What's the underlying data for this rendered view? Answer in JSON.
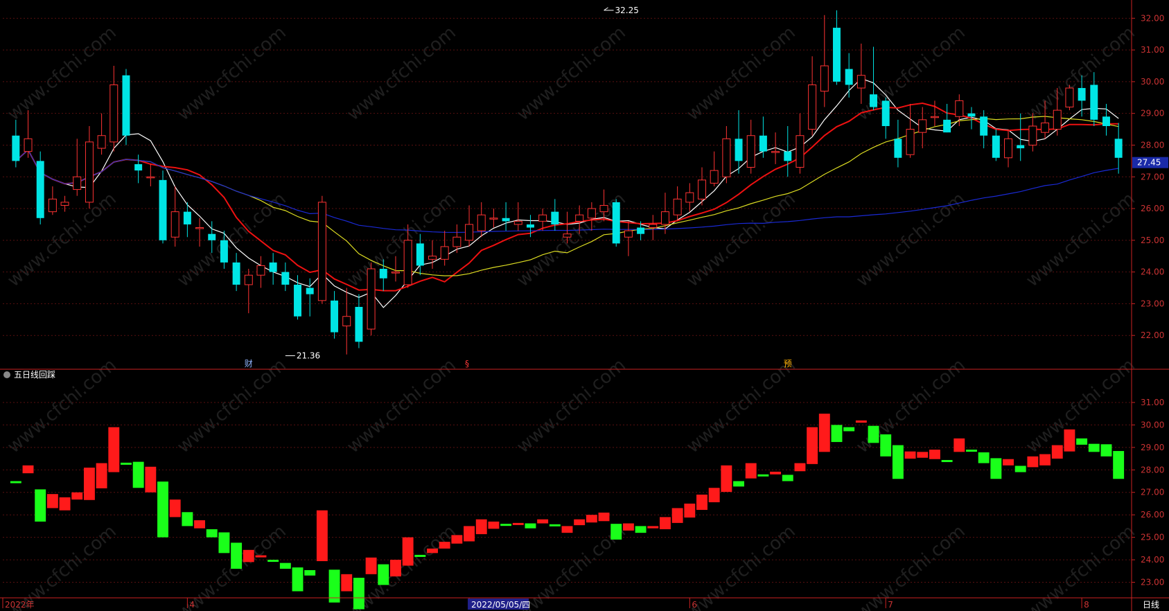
{
  "chart_data": [
    {
      "type": "candlestick",
      "title": "",
      "ylim": [
        21.0,
        32.4
      ],
      "y_ticks": [
        "22.00",
        "23.00",
        "24.00",
        "25.00",
        "26.00",
        "27.00",
        "28.00",
        "29.00",
        "30.00",
        "31.00",
        "32.00"
      ],
      "current_price_label": "27.45",
      "current_price": 27.45,
      "high_annotation": {
        "label": "32.25",
        "value": 32.25,
        "index": 48
      },
      "low_annotation": {
        "label": "21.36",
        "value": 21.36,
        "index": 22
      },
      "event_markers": [
        {
          "label": "财",
          "index": 19,
          "color": "#8fb4ff"
        },
        {
          "label": "§",
          "index": 37,
          "color": "#ff3a3a"
        },
        {
          "label": "预",
          "index": 63,
          "color": "#ffb000"
        }
      ],
      "candles": [
        {
          "o": 28.3,
          "c": 27.5,
          "h": 28.8,
          "l": 27.3
        },
        {
          "o": 27.8,
          "c": 28.2,
          "h": 29.1,
          "l": 27.6
        },
        {
          "o": 27.5,
          "c": 25.7,
          "h": 27.8,
          "l": 25.5
        },
        {
          "o": 25.9,
          "c": 26.3,
          "h": 26.7,
          "l": 25.8
        },
        {
          "o": 26.1,
          "c": 26.2,
          "h": 26.4,
          "l": 25.9
        },
        {
          "o": 26.6,
          "c": 27.0,
          "h": 28.2,
          "l": 26.4
        },
        {
          "o": 26.2,
          "c": 28.1,
          "h": 28.6,
          "l": 26.0
        },
        {
          "o": 27.9,
          "c": 28.3,
          "h": 29.0,
          "l": 27.7
        },
        {
          "o": 28.1,
          "c": 29.9,
          "h": 30.5,
          "l": 27.8
        },
        {
          "o": 30.2,
          "c": 28.3,
          "h": 30.4,
          "l": 28.0
        },
        {
          "o": 27.4,
          "c": 27.2,
          "h": 27.7,
          "l": 26.8
        },
        {
          "o": 27.0,
          "c": 27.0,
          "h": 27.4,
          "l": 26.7
        },
        {
          "o": 26.9,
          "c": 25.0,
          "h": 27.2,
          "l": 24.9
        },
        {
          "o": 25.1,
          "c": 25.9,
          "h": 26.7,
          "l": 24.8
        },
        {
          "o": 25.9,
          "c": 25.5,
          "h": 26.2,
          "l": 25.1
        },
        {
          "o": 25.4,
          "c": 25.4,
          "h": 25.7,
          "l": 24.8
        },
        {
          "o": 25.2,
          "c": 25.0,
          "h": 25.6,
          "l": 24.6
        },
        {
          "o": 25.0,
          "c": 24.3,
          "h": 25.3,
          "l": 24.1
        },
        {
          "o": 24.3,
          "c": 23.6,
          "h": 24.6,
          "l": 23.4
        },
        {
          "o": 23.6,
          "c": 23.9,
          "h": 24.1,
          "l": 22.7
        },
        {
          "o": 23.9,
          "c": 24.2,
          "h": 24.5,
          "l": 23.5
        },
        {
          "o": 24.3,
          "c": 24.0,
          "h": 24.6,
          "l": 23.6
        },
        {
          "o": 24.0,
          "c": 23.6,
          "h": 24.3,
          "l": 23.4
        },
        {
          "o": 23.6,
          "c": 22.6,
          "h": 23.9,
          "l": 22.5
        },
        {
          "o": 23.5,
          "c": 23.3,
          "h": 23.8,
          "l": 22.6
        },
        {
          "o": 23.1,
          "c": 26.2,
          "h": 26.4,
          "l": 23.0
        },
        {
          "o": 23.1,
          "c": 22.1,
          "h": 23.4,
          "l": 21.9
        },
        {
          "o": 22.3,
          "c": 22.6,
          "h": 23.5,
          "l": 21.4
        },
        {
          "o": 22.9,
          "c": 21.8,
          "h": 23.3,
          "l": 21.6
        },
        {
          "o": 22.2,
          "c": 24.1,
          "h": 24.3,
          "l": 22.0
        },
        {
          "o": 24.1,
          "c": 23.8,
          "h": 24.4,
          "l": 23.4
        },
        {
          "o": 24.0,
          "c": 24.0,
          "h": 24.5,
          "l": 23.7
        },
        {
          "o": 23.6,
          "c": 25.0,
          "h": 25.5,
          "l": 23.5
        },
        {
          "o": 24.9,
          "c": 24.2,
          "h": 25.2,
          "l": 23.9
        },
        {
          "o": 24.4,
          "c": 24.5,
          "h": 25.0,
          "l": 24.1
        },
        {
          "o": 24.4,
          "c": 24.8,
          "h": 25.3,
          "l": 24.2
        },
        {
          "o": 24.8,
          "c": 25.1,
          "h": 25.5,
          "l": 24.6
        },
        {
          "o": 25.0,
          "c": 25.5,
          "h": 26.1,
          "l": 24.8
        },
        {
          "o": 25.3,
          "c": 25.8,
          "h": 26.2,
          "l": 25.1
        },
        {
          "o": 25.7,
          "c": 25.7,
          "h": 26.0,
          "l": 25.4
        },
        {
          "o": 25.7,
          "c": 25.6,
          "h": 26.2,
          "l": 25.3
        },
        {
          "o": 25.5,
          "c": 25.6,
          "h": 26.2,
          "l": 25.3
        },
        {
          "o": 25.5,
          "c": 25.4,
          "h": 25.8,
          "l": 25.1
        },
        {
          "o": 25.6,
          "c": 25.8,
          "h": 26.0,
          "l": 25.3
        },
        {
          "o": 25.9,
          "c": 25.5,
          "h": 26.3,
          "l": 25.3
        },
        {
          "o": 25.1,
          "c": 25.2,
          "h": 25.9,
          "l": 24.9
        },
        {
          "o": 25.6,
          "c": 25.8,
          "h": 26.1,
          "l": 25.2
        },
        {
          "o": 25.7,
          "c": 26.0,
          "h": 26.2,
          "l": 25.3
        },
        {
          "o": 25.9,
          "c": 26.1,
          "h": 26.6,
          "l": 25.6
        },
        {
          "o": 26.2,
          "c": 24.9,
          "h": 26.3,
          "l": 24.8
        },
        {
          "o": 25.1,
          "c": 25.3,
          "h": 25.6,
          "l": 24.5
        },
        {
          "o": 25.4,
          "c": 25.2,
          "h": 25.6,
          "l": 25.0
        },
        {
          "o": 25.4,
          "c": 25.5,
          "h": 25.8,
          "l": 25.0
        },
        {
          "o": 25.5,
          "c": 25.9,
          "h": 26.5,
          "l": 25.2
        },
        {
          "o": 25.8,
          "c": 26.3,
          "h": 26.7,
          "l": 25.6
        },
        {
          "o": 26.2,
          "c": 26.5,
          "h": 26.8,
          "l": 25.9
        },
        {
          "o": 26.3,
          "c": 26.9,
          "h": 27.3,
          "l": 26.1
        },
        {
          "o": 26.8,
          "c": 27.2,
          "h": 27.8,
          "l": 26.7
        },
        {
          "o": 27.0,
          "c": 28.2,
          "h": 28.6,
          "l": 26.8
        },
        {
          "o": 28.2,
          "c": 27.5,
          "h": 29.1,
          "l": 27.1
        },
        {
          "o": 27.3,
          "c": 28.3,
          "h": 28.8,
          "l": 27.1
        },
        {
          "o": 28.3,
          "c": 27.8,
          "h": 28.9,
          "l": 27.6
        },
        {
          "o": 27.8,
          "c": 27.8,
          "h": 28.4,
          "l": 27.4
        },
        {
          "o": 27.8,
          "c": 27.5,
          "h": 28.6,
          "l": 27.0
        },
        {
          "o": 27.3,
          "c": 28.3,
          "h": 29.0,
          "l": 27.1
        },
        {
          "o": 28.5,
          "c": 29.9,
          "h": 30.8,
          "l": 28.3
        },
        {
          "o": 29.7,
          "c": 30.5,
          "h": 32.1,
          "l": 29.2
        },
        {
          "o": 31.7,
          "c": 30.0,
          "h": 32.25,
          "l": 29.9
        },
        {
          "o": 30.4,
          "c": 29.9,
          "h": 30.9,
          "l": 29.5
        },
        {
          "o": 29.8,
          "c": 30.2,
          "h": 31.2,
          "l": 29.3
        },
        {
          "o": 29.6,
          "c": 29.2,
          "h": 31.1,
          "l": 29.1
        },
        {
          "o": 29.4,
          "c": 28.6,
          "h": 29.5,
          "l": 28.2
        },
        {
          "o": 28.2,
          "c": 27.6,
          "h": 28.8,
          "l": 27.3
        },
        {
          "o": 27.7,
          "c": 28.5,
          "h": 29.3,
          "l": 27.6
        },
        {
          "o": 28.4,
          "c": 28.8,
          "h": 29.2,
          "l": 27.9
        },
        {
          "o": 28.9,
          "c": 28.9,
          "h": 29.4,
          "l": 28.6
        },
        {
          "o": 28.8,
          "c": 28.4,
          "h": 29.3,
          "l": 28.4
        },
        {
          "o": 28.9,
          "c": 29.4,
          "h": 29.6,
          "l": 28.6
        },
        {
          "o": 29.0,
          "c": 28.9,
          "h": 29.2,
          "l": 28.5
        },
        {
          "o": 28.9,
          "c": 28.3,
          "h": 29.1,
          "l": 27.9
        },
        {
          "o": 28.3,
          "c": 27.6,
          "h": 28.5,
          "l": 27.5
        },
        {
          "o": 27.6,
          "c": 28.2,
          "h": 28.5,
          "l": 27.3
        },
        {
          "o": 28.0,
          "c": 27.9,
          "h": 29.0,
          "l": 27.5
        },
        {
          "o": 28.0,
          "c": 28.6,
          "h": 29.0,
          "l": 27.8
        },
        {
          "o": 28.4,
          "c": 28.7,
          "h": 29.4,
          "l": 28.2
        },
        {
          "o": 28.5,
          "c": 29.1,
          "h": 29.8,
          "l": 28.3
        },
        {
          "o": 29.2,
          "c": 29.8,
          "h": 29.9,
          "l": 29.1
        },
        {
          "o": 29.8,
          "c": 29.4,
          "h": 30.2,
          "l": 28.9
        },
        {
          "o": 29.9,
          "c": 28.8,
          "h": 30.3,
          "l": 28.6
        },
        {
          "o": 28.9,
          "c": 28.6,
          "h": 29.3,
          "l": 28.3
        },
        {
          "o": 28.2,
          "c": 27.6,
          "h": 28.7,
          "l": 27.1
        }
      ],
      "ma_lines": [
        {
          "name": "MA5",
          "color": "#ffffff"
        },
        {
          "name": "MA10",
          "color": "#ee1111"
        },
        {
          "name": "MA20",
          "color": "#dddd22"
        },
        {
          "name": "MA60",
          "color": "#1a2ad6"
        }
      ]
    },
    {
      "type": "bar",
      "title": "五日线回踩",
      "ylim": [
        22.4,
        31.8
      ],
      "y_ticks": [
        "23.00",
        "24.00",
        "25.00",
        "26.00",
        "27.00",
        "28.00",
        "29.00",
        "30.00",
        "31.00"
      ],
      "colors": {
        "up": "#ff1a1a",
        "down": "#1aff1a"
      }
    }
  ],
  "bottom_axis": {
    "labels": [
      {
        "text": "2022年",
        "index": 0
      },
      {
        "text": "4",
        "index": 14
      },
      {
        "text": "2022/05/05/四",
        "index": 37,
        "highlight": true
      },
      {
        "text": "6",
        "index": 55
      },
      {
        "text": "7",
        "index": 71
      },
      {
        "text": "8",
        "index": 87
      }
    ],
    "period_label": "日线"
  },
  "watermark_text": "www.cfchi.com",
  "colors": {
    "up": "#ff3333",
    "down": "#00e5e5",
    "axis": "#cc2222",
    "grid": "#5a1010",
    "price_tag_bg": "#1a2aa8"
  }
}
